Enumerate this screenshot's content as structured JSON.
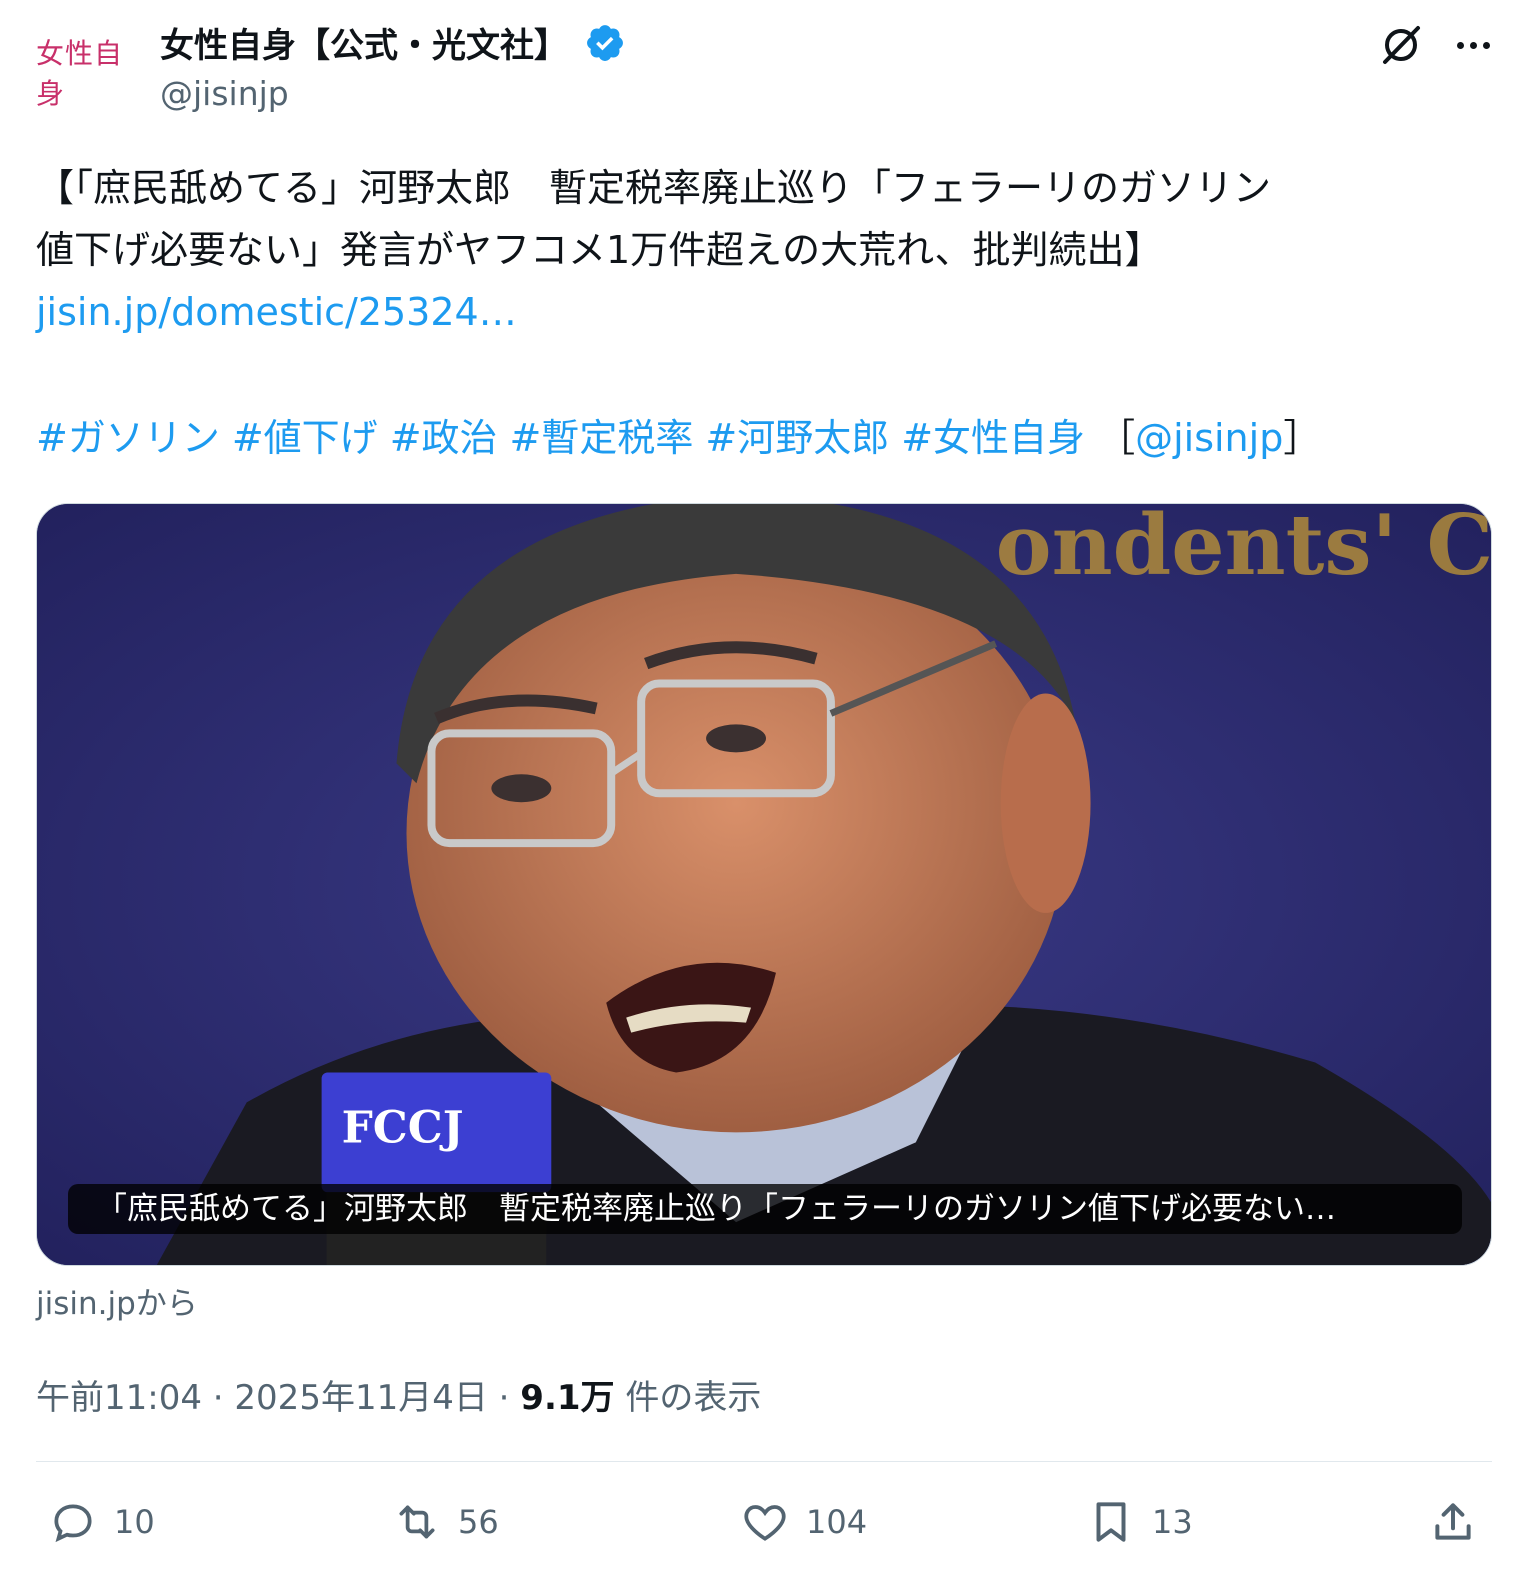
{
  "author": {
    "avatar_text": "女性自身",
    "display_name": "女性自身【公式・光文社】",
    "handle": "@jisinjp",
    "verified_icon": "verified-badge-icon"
  },
  "tweet": {
    "line1": "【「庶民舐めてる」河野太郎　暫定税率廃止巡り「フェラーリのガソリン",
    "line2": "値下げ必要ない」発言がヤフコメ1万件超えの大荒れ、批判続出】",
    "link": "jisin.jp/domestic/25324…",
    "hashtags": [
      "#ガソリン",
      "#値下げ",
      "#政治",
      "#暫定税率",
      "#河野太郎",
      "#女性自身"
    ],
    "mention_open": "［",
    "mention": "@jisinjp",
    "mention_close": "］"
  },
  "card": {
    "caption": "「庶民舐めてる」河野太郎　暫定税率廃止巡り「フェラーリのガソリン値下げ必要ない…",
    "mic_label": "FCCJ",
    "backdrop_text": "ondents' Clu",
    "source": "jisin.jpから"
  },
  "meta": {
    "time": "午前11:04",
    "sep1": " · ",
    "date": "2025年11月4日",
    "sep2": " · ",
    "views": "9.1万",
    "views_label": " 件の表示"
  },
  "actions": {
    "replies": "10",
    "reposts": "56",
    "likes": "104",
    "bookmarks": "13"
  },
  "colors": {
    "link": "#1d9bf0",
    "secondary": "#536471",
    "text": "#0f1419"
  }
}
